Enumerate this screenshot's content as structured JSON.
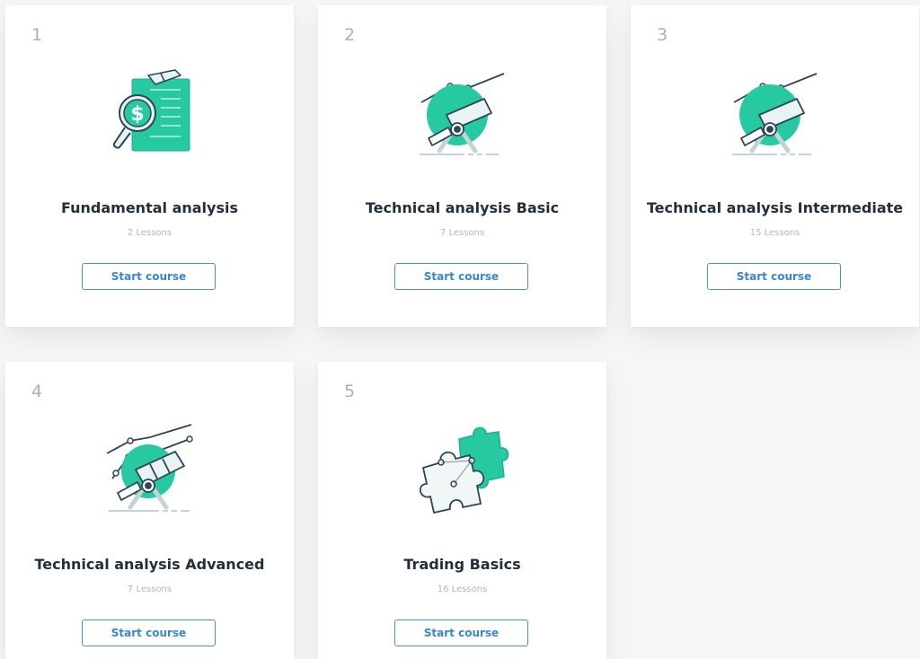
{
  "courses": [
    {
      "number": "1",
      "title": "Fundamental analysis",
      "lessons": "2 Lessons",
      "button_label": "Start course",
      "icon": "dollar-document-magnifier-icon"
    },
    {
      "number": "2",
      "title": "Technical analysis Basic",
      "lessons": "7 Lessons",
      "button_label": "Start course",
      "icon": "telescope-chart-icon"
    },
    {
      "number": "3",
      "title": "Technical analysis Intermediate",
      "lessons": "15 Lessons",
      "button_label": "Start course",
      "icon": "telescope-chart-icon"
    },
    {
      "number": "4",
      "title": "Technical analysis Advanced",
      "lessons": "7 Lessons",
      "button_label": "Start course",
      "icon": "telescope-chart-advanced-icon"
    },
    {
      "number": "5",
      "title": "Trading Basics",
      "lessons": "16 Lessons",
      "button_label": "Start course",
      "icon": "puzzle-pieces-icon"
    }
  ],
  "colors": {
    "accent_green": "#27c9a2",
    "outline": "#2e4553",
    "button_blue": "#3a86d4",
    "title_text": "#22303e",
    "muted_text": "#b1b6bc",
    "number_text": "#a9b0b8"
  }
}
